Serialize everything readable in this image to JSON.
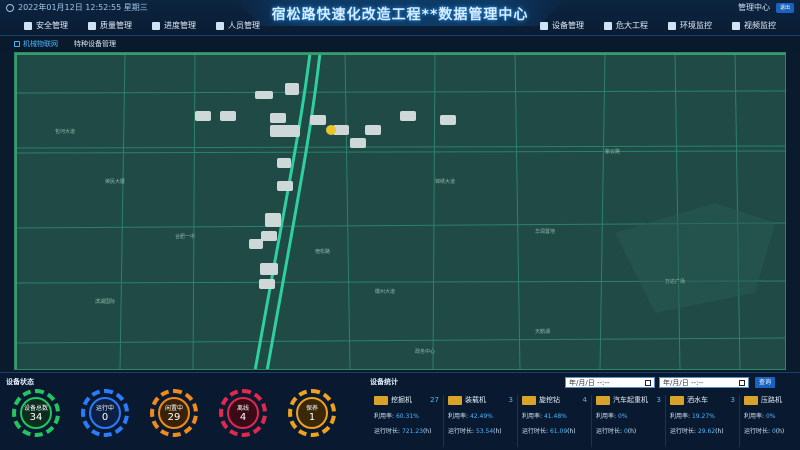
{
  "header": {
    "datetime": "2022年01月12日 12:52:55 星期三",
    "title": "宿松路快速化改造工程**数据管理中心",
    "admin": "管理中心",
    "admin_btn": "退出",
    "nav_left": [
      "安全管理",
      "质量管理",
      "进度管理",
      "人员管理"
    ],
    "nav_right": [
      "设备管理",
      "危大工程",
      "环境监控",
      "视频监控"
    ]
  },
  "subtabs": [
    "机械物联网",
    "特种设备管理"
  ],
  "device_status": {
    "title": "设备状态",
    "gauges": [
      {
        "label": "设备总数",
        "value": "34",
        "color": "#22c55e"
      },
      {
        "label": "运行中",
        "value": "0",
        "color": "#2b7bff"
      },
      {
        "label": "闲置中",
        "value": "29",
        "color": "#f08a1c"
      },
      {
        "label": "离线",
        "value": "4",
        "color": "#e5274f"
      },
      {
        "label": "保养",
        "value": "1",
        "color": "#f0a01c"
      }
    ]
  },
  "device_stats": {
    "title": "设备统计",
    "date_placeholder": "年/月/日 --:--",
    "query": "查询",
    "equipment": [
      {
        "name": "挖掘机",
        "count": "27",
        "util_label": "利用率:",
        "util": "60.31%",
        "run_label": "运行时长:",
        "run": "721.23",
        "unit": "(h)"
      },
      {
        "name": "装载机",
        "count": "3",
        "util_label": "利用率:",
        "util": "42.49%",
        "run_label": "运行时长:",
        "run": "53.54",
        "unit": "(h)"
      },
      {
        "name": "旋挖钻",
        "count": "4",
        "util_label": "利用率:",
        "util": "41.48%",
        "run_label": "运行时长:",
        "run": "61.09",
        "unit": "(h)"
      },
      {
        "name": "汽车起重机",
        "count": "3",
        "util_label": "利用率:",
        "util": "0%",
        "run_label": "运行时长:",
        "run": "0",
        "unit": "(h)"
      },
      {
        "name": "洒水车",
        "count": "3",
        "util_label": "利用率:",
        "util": "19.27%",
        "run_label": "运行时长:",
        "run": "29.62",
        "unit": "(h)"
      },
      {
        "name": "压路机",
        "count": "",
        "util_label": "利用率:",
        "util": "0%",
        "run_label": "运行时长:",
        "run": "0",
        "unit": "(h)"
      }
    ]
  },
  "map": {
    "labels": [
      "荣民大厦",
      "合肥一中",
      "滨湖国际",
      "天鹅湖",
      "宿松路",
      "锦绣大道",
      "紫云路",
      "徽州大道",
      "华润置地",
      "政务中心",
      "万达广场",
      "包河大道"
    ]
  }
}
